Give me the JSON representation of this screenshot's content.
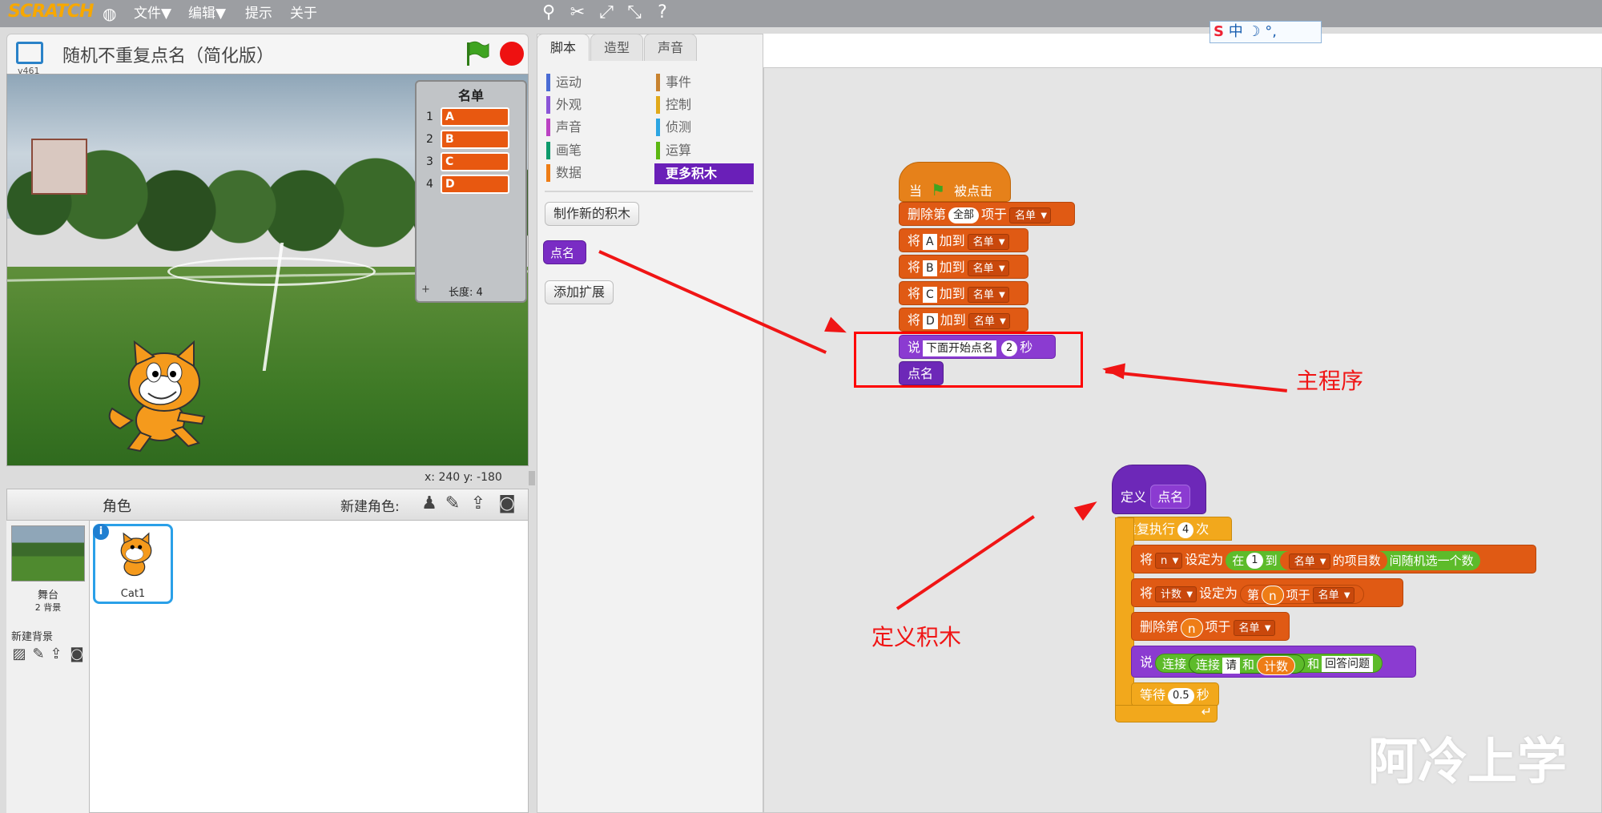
{
  "menu": {
    "logo": "SCRATCH",
    "file": "文件▼",
    "edit": "编辑▼",
    "tips": "提示",
    "about": "关于"
  },
  "toolbar_icons": [
    "duplicate-icon",
    "delete-icon",
    "grow-icon",
    "shrink-icon",
    "help-icon"
  ],
  "ime": "中 ☽ °, ",
  "stage": {
    "title": "随机不重复点名（简化版）",
    "version": "v461",
    "coords": "x: 240   y: -180"
  },
  "list_monitor": {
    "title": "名单",
    "items": [
      {
        "i": "1",
        "v": "A"
      },
      {
        "i": "2",
        "v": "B"
      },
      {
        "i": "3",
        "v": "C"
      },
      {
        "i": "4",
        "v": "D"
      }
    ],
    "length": "长度: 4",
    "plus": "+"
  },
  "sprites": {
    "header": "角色",
    "new_sprite": "新建角色:",
    "stage_name": "舞台",
    "stage_bg": "2 背景",
    "new_bg": "新建背景",
    "sprite_name": "Cat1",
    "info": "i"
  },
  "tabs": {
    "scripts": "脚本",
    "costumes": "造型",
    "sounds": "声音"
  },
  "categories": {
    "motion": "运动",
    "looks": "外观",
    "sound": "声音",
    "pen": "画笔",
    "data": "数据",
    "events": "事件",
    "control": "控制",
    "sensing": "侦测",
    "operators": "运算",
    "more": "更多积木"
  },
  "palette": {
    "make_block": "制作新的积木",
    "custom_block": "点名",
    "add_ext": "添加扩展"
  },
  "main_script": {
    "when": "当",
    "clicked": "被点击",
    "delete": "删除第",
    "delete_all": "全部",
    "of_item": "项于",
    "list": "名单",
    "add": "将",
    "to": "加到",
    "vals": [
      "A",
      "B",
      "C",
      "D"
    ],
    "say": "说",
    "say_text": "下面开始点名",
    "say_secs": "2",
    "secs": "秒",
    "call": "点名"
  },
  "def_script": {
    "define": "定义",
    "name": "点名",
    "repeat": "重复执行",
    "repeat_n": "4",
    "times": "次",
    "set": "将",
    "var_n": "n",
    "set_to": "设定为",
    "in": "在",
    "one": "1",
    "to_word": "到",
    "list": "名单",
    "item_count": "的项目数",
    "pick_random": "间随机选一个数",
    "var_count": "计数",
    "item_word": "第",
    "item_of": "项于",
    "delete": "删除第",
    "say": "说",
    "join": "连接",
    "please": "请",
    "and": "和",
    "answer": "回答问题",
    "wait": "等待",
    "wait_n": "0.5",
    "secs": "秒"
  },
  "annotations": {
    "main": "主程序",
    "define": "定义积木"
  },
  "watermark": "阿冷上学",
  "colors": {
    "events": "#e6811a",
    "data": "#e05a14",
    "looks": "#8b3bd1",
    "custom": "#6d28b8",
    "control": "#f2a81c",
    "operators": "#5dbb2a",
    "annotation": "#f01515"
  }
}
